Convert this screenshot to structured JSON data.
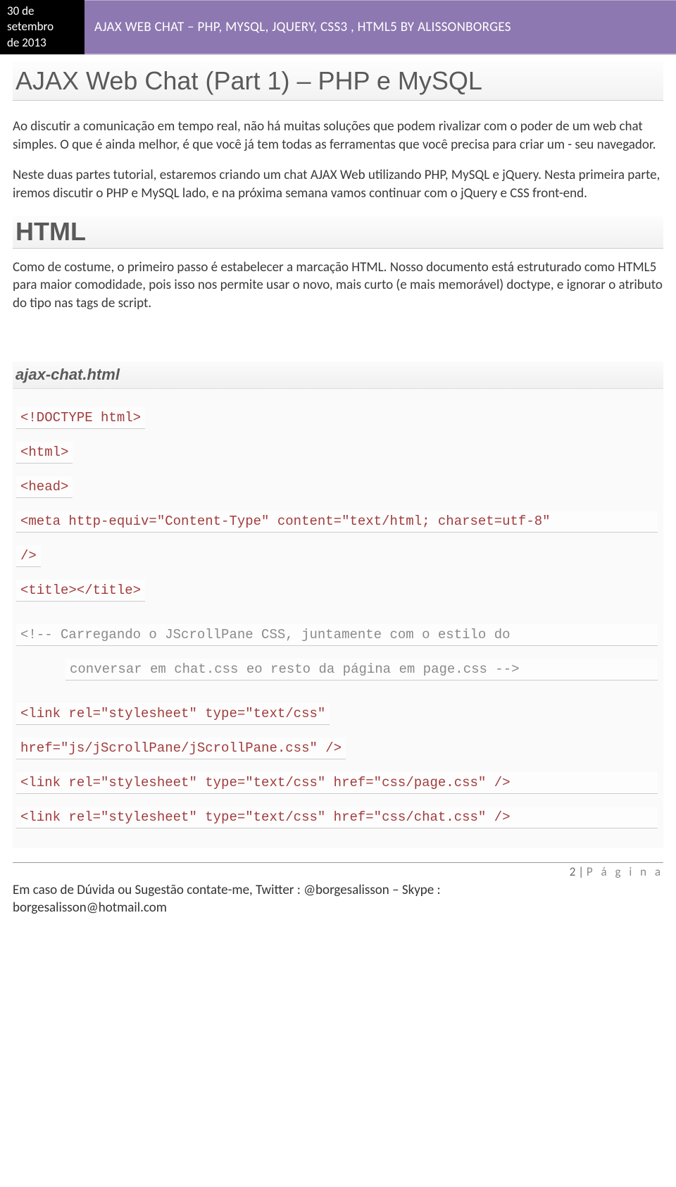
{
  "header": {
    "date_line1": "30 de",
    "date_line2": "setembro",
    "date_line3": "de 2013",
    "doc_title": "AJAX WEB CHAT – PHP, MYSQL, JQUERY, CSS3 , HTML5 BY ALISSONBORGES"
  },
  "main": {
    "page_title": "AJAX Web Chat (Part 1) – PHP e MySQL",
    "para1": "Ao discutir a comunicação em tempo real, não há muitas soluções que podem rivalizar com o poder de um web chat simples. O que é ainda melhor, é que você já tem todas as ferramentas que você precisa para criar um - seu navegador.",
    "para2": "Neste duas partes tutorial, estaremos criando um chat AJAX Web utilizando PHP, MySQL e jQuery. Nesta primeira parte, iremos discutir o PHP e MySQL lado, e na próxima semana vamos continuar com o jQuery e CSS front-end.",
    "section_heading": "HTML",
    "para3": "Como de costume, o primeiro passo é estabelecer a marcação HTML. Nosso documento está estruturado como HTML5 para maior comodidade, pois isso nos permite usar o novo, mais curto (e mais memorável) doctype, e ignorar o atributo do tipo nas tags de script."
  },
  "code": {
    "filename": "ajax-chat.html",
    "l1": "<!DOCTYPE html>",
    "l2": "<html>",
    "l3": "<head>",
    "l4": "<meta http-equiv=\"Content-Type\" content=\"text/html; charset=utf-8\"",
    "l5": "/>",
    "l6": "<title></title>",
    "l7": "<!-- Carregando o JScrollPane CSS, juntamente com o estilo do",
    "l8": "conversar em chat.css eo resto da página em page.css -->",
    "l9": "<link rel=\"stylesheet\" type=\"text/css\"",
    "l10": "href=\"js/jScrollPane/jScrollPane.css\" />",
    "l11": "<link rel=\"stylesheet\" type=\"text/css\" href=\"css/page.css\" />",
    "l12": "<link rel=\"stylesheet\" type=\"text/css\" href=\"css/chat.css\" />"
  },
  "footer": {
    "page_num_label": "2 | ",
    "page_word": "P á g i n a",
    "contact_l1": "Em caso de Dúvida ou Sugestão contate-me, Twitter : @borgesalisson – Skype :",
    "contact_l2": "borgesalisson@hotmail.com"
  }
}
